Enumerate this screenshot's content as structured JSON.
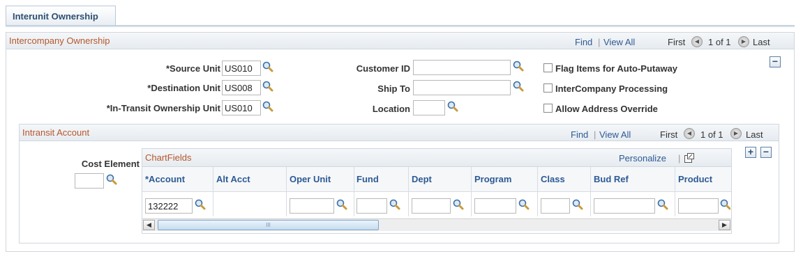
{
  "tab": {
    "label": "Interunit Ownership"
  },
  "ownership": {
    "title": "Intercompany Ownership",
    "find": "Find",
    "view_all": "View All",
    "first": "First",
    "range": "1 of 1",
    "last": "Last",
    "collapse": "−",
    "source_unit": {
      "label": "*Source Unit",
      "value": "US010"
    },
    "destination_unit": {
      "label": "*Destination Unit",
      "value": "US008"
    },
    "transit_unit": {
      "label": "*In-Transit Ownership Unit",
      "value": "US010"
    },
    "customer_id": {
      "label": "Customer ID",
      "value": ""
    },
    "ship_to": {
      "label": "Ship To",
      "value": ""
    },
    "location": {
      "label": "Location",
      "value": ""
    },
    "flag_items": {
      "label": "Flag Items for Auto-Putaway"
    },
    "interco_proc": {
      "label": "InterCompany Processing"
    },
    "allow_override": {
      "label": "Allow Address Override"
    }
  },
  "intransit": {
    "title": "Intransit Account",
    "find": "Find",
    "view_all": "View All",
    "first": "First",
    "range": "1 of 1",
    "last": "Last",
    "cost_element": {
      "label": "Cost Element",
      "value": ""
    },
    "add": "+",
    "remove": "−"
  },
  "chartfields": {
    "title": "ChartFields",
    "personalize": "Personalize",
    "columns": [
      "*Account",
      "Alt Acct",
      "Oper Unit",
      "Fund",
      "Dept",
      "Program",
      "Class",
      "Bud Ref",
      "Product"
    ],
    "row": {
      "account": "132222"
    },
    "scroll_mid": "III"
  }
}
